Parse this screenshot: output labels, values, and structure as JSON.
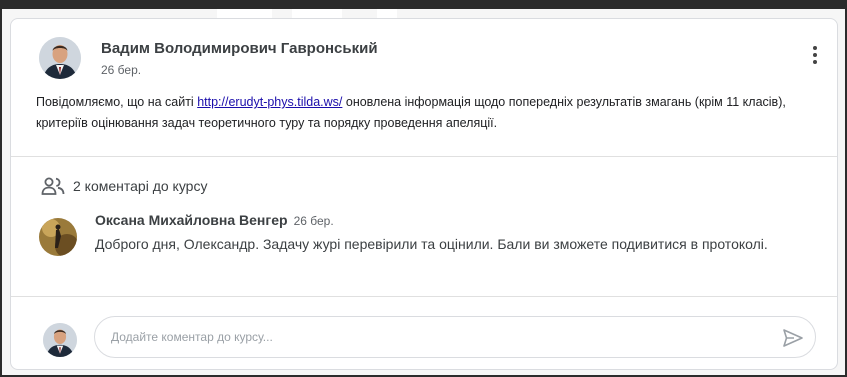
{
  "post": {
    "author_name": "Вадим Володимирович Гавронський",
    "date": "26 бер.",
    "text_before_link": "Повідомляємо, що на сайті ",
    "link_text": "http://erudyt-phys.tilda.ws/",
    "text_after_link": " оновлена інформація щодо попередніх результатів змагань (крім 11 класів), критеріїв оцінювання задач теоретичного туру та порядку проведення апеляції.",
    "more_icon": "more-vert-icon"
  },
  "comments_section": {
    "count_label": "2 коментарі до курсу",
    "icon": "people-icon"
  },
  "comment": {
    "author_name": "Оксана Михайловна Венгер",
    "date": "26 бер.",
    "text": "Доброго дня, Олександр. Задачу  журі перевірили та оцінили. Бали ви зможете подивитися в протоколі."
  },
  "reply": {
    "placeholder": "Додайте коментар до курсу...",
    "value": "",
    "send_icon": "send-icon"
  },
  "colors": {
    "link": "#1a0dab",
    "border": "#dadce0",
    "text": "#3c4043"
  }
}
